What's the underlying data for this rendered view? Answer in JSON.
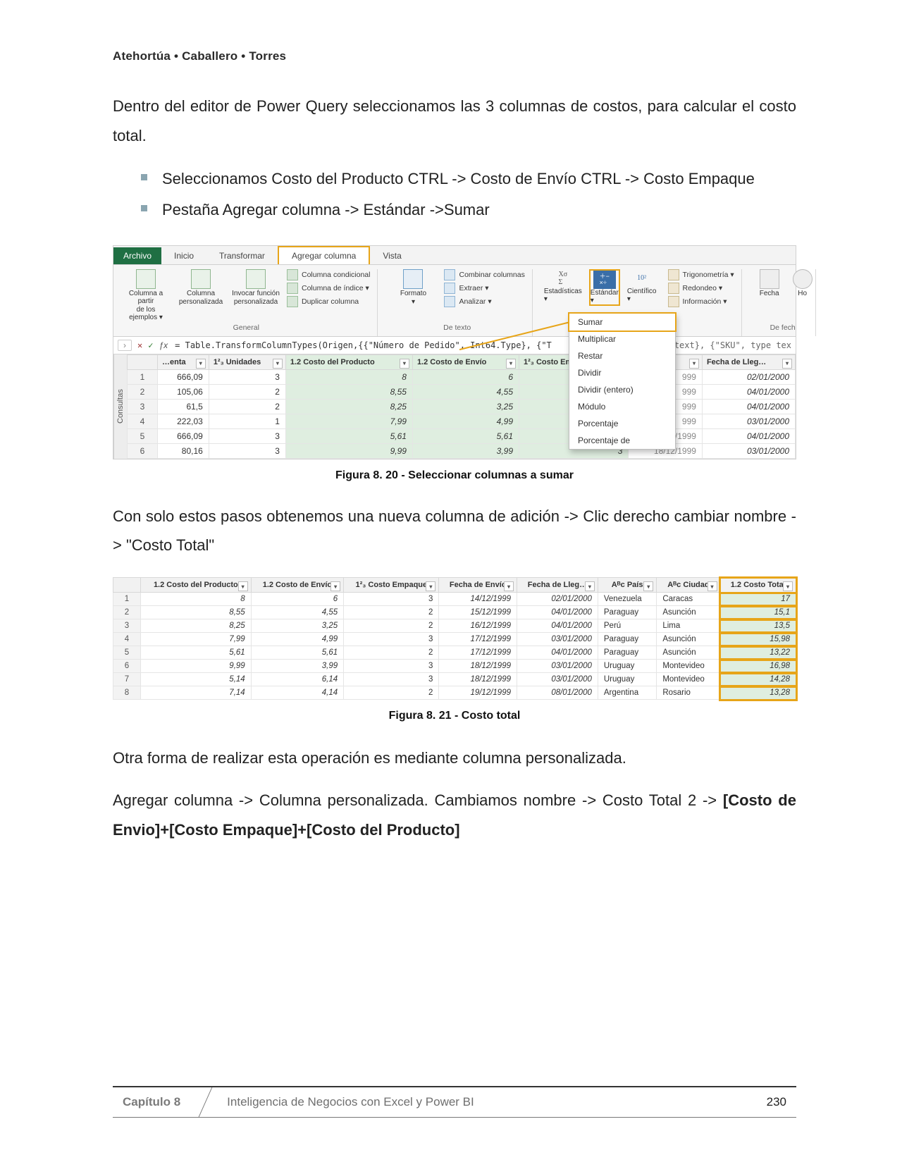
{
  "running_head": "Atehortúa • Caballero • Torres",
  "intro": "Dentro del editor de Power Query seleccionamos las 3 columnas de costos, para calcular el costo total.",
  "bullets": [
    "Seleccionamos Costo del Producto CTRL -> Costo de Envío CTRL -> Costo Empaque",
    "Pestaña Agregar columna -> Estándar ->Sumar"
  ],
  "fig20": {
    "tabs": {
      "file": "Archivo",
      "items": [
        "Inicio",
        "Transformar",
        "Agregar columna",
        "Vista"
      ],
      "activeIndex": 2
    },
    "ribbon": {
      "general": {
        "label": "General",
        "big": [
          {
            "l1": "Columna a partir",
            "l2": "de los ejemplos ▾"
          },
          {
            "l1": "Columna",
            "l2": "personalizada"
          },
          {
            "l1": "Invocar función",
            "l2": "personalizada"
          }
        ],
        "stack": [
          "Columna condicional",
          "Columna de índice ▾",
          "Duplicar columna"
        ]
      },
      "texto": {
        "label": "De texto",
        "big": {
          "l1": "Formato",
          "l2": "▾"
        },
        "stack": [
          "Combinar columnas",
          "Extraer ▾",
          "Analizar ▾"
        ]
      },
      "num": {
        "label": "",
        "items": [
          {
            "icon": "Χσ / Σ",
            "label": "Estadísticas ▾"
          },
          {
            "icon": "+− / ×÷",
            "label": "Estándar ▾",
            "hi": true
          },
          {
            "icon": "10²",
            "label": "Científico ▾"
          }
        ],
        "extra": [
          "Trigonometría ▾",
          "Redondeo ▾",
          "Información ▾"
        ]
      },
      "fecha": {
        "label": "De fech",
        "items": [
          "Fecha",
          "Ho"
        ]
      }
    },
    "dropdown": [
      "Sumar",
      "Multiplicar",
      "Restar",
      "Dividir",
      "Dividir (entero)",
      "Módulo",
      "Porcentaje",
      "Porcentaje de"
    ],
    "formula_left": "= Table.TransformColumnTypes(Origen,{{\"Número de Pedido\", Int64.Type}, {\"T",
    "formula_right": "text}, {\"SKU\", type tex",
    "columns": [
      "…enta",
      "1²₃ Unidades",
      "1.2 Costo del Producto",
      "1.2 Costo de Envío",
      "1²₃ Costo Empaque",
      "",
      "Fecha de Lleg…"
    ],
    "date_tail": [
      "999",
      "999",
      "999",
      "999",
      "17/12/1999",
      "18/12/1999"
    ],
    "rows": [
      {
        "n": 1,
        "venta": "666,09",
        "uni": "3",
        "cp": "8",
        "ce": "6",
        "cq": "",
        "fl": "02/01/2000"
      },
      {
        "n": 2,
        "venta": "105,06",
        "uni": "2",
        "cp": "8,55",
        "ce": "4,55",
        "cq": "",
        "fl": "04/01/2000"
      },
      {
        "n": 3,
        "venta": "61,5",
        "uni": "2",
        "cp": "8,25",
        "ce": "3,25",
        "cq": "",
        "fl": "04/01/2000"
      },
      {
        "n": 4,
        "venta": "222,03",
        "uni": "1",
        "cp": "7,99",
        "ce": "4,99",
        "cq": "",
        "fl": "03/01/2000"
      },
      {
        "n": 5,
        "venta": "666,09",
        "uni": "3",
        "cp": "5,61",
        "ce": "5,61",
        "cq": "",
        "fl": "04/01/2000"
      },
      {
        "n": 6,
        "venta": "80,16",
        "uni": "3",
        "cp": "9,99",
        "ce": "3,99",
        "cq": "3",
        "fl": "03/01/2000"
      }
    ],
    "sidetab": "Consultas",
    "caption": "Figura 8. 20 - Seleccionar columnas a sumar"
  },
  "mid_para": "Con solo estos pasos obtenemos una nueva columna de adición -> Clic derecho cambiar nombre -> \"Costo Total\"",
  "fig21": {
    "columns": [
      "1.2 Costo del Producto",
      "1.2 Costo de Envío",
      "1²₃ Costo Empaque",
      "Fecha de Envío",
      "Fecha de Lleg…",
      "Aᴮc País",
      "Aᴮc Ciudad",
      "1.2 Costo Total"
    ],
    "rows": [
      {
        "n": 1,
        "cp": "8",
        "ce": "6",
        "cq": "3",
        "fe": "14/12/1999",
        "fl": "02/01/2000",
        "pais": "Venezuela",
        "ciu": "Caracas",
        "ct": "17"
      },
      {
        "n": 2,
        "cp": "8,55",
        "ce": "4,55",
        "cq": "2",
        "fe": "15/12/1999",
        "fl": "04/01/2000",
        "pais": "Paraguay",
        "ciu": "Asunción",
        "ct": "15,1"
      },
      {
        "n": 3,
        "cp": "8,25",
        "ce": "3,25",
        "cq": "2",
        "fe": "16/12/1999",
        "fl": "04/01/2000",
        "pais": "Perú",
        "ciu": "Lima",
        "ct": "13,5"
      },
      {
        "n": 4,
        "cp": "7,99",
        "ce": "4,99",
        "cq": "3",
        "fe": "17/12/1999",
        "fl": "03/01/2000",
        "pais": "Paraguay",
        "ciu": "Asunción",
        "ct": "15,98"
      },
      {
        "n": 5,
        "cp": "5,61",
        "ce": "5,61",
        "cq": "2",
        "fe": "17/12/1999",
        "fl": "04/01/2000",
        "pais": "Paraguay",
        "ciu": "Asunción",
        "ct": "13,22"
      },
      {
        "n": 6,
        "cp": "9,99",
        "ce": "3,99",
        "cq": "3",
        "fe": "18/12/1999",
        "fl": "03/01/2000",
        "pais": "Uruguay",
        "ciu": "Montevideo",
        "ct": "16,98"
      },
      {
        "n": 7,
        "cp": "5,14",
        "ce": "6,14",
        "cq": "3",
        "fe": "18/12/1999",
        "fl": "03/01/2000",
        "pais": "Uruguay",
        "ciu": "Montevideo",
        "ct": "14,28"
      },
      {
        "n": 8,
        "cp": "7,14",
        "ce": "4,14",
        "cq": "2",
        "fe": "19/12/1999",
        "fl": "08/01/2000",
        "pais": "Argentina",
        "ciu": "Rosario",
        "ct": "13,28"
      }
    ],
    "caption": "Figura 8. 21 - Costo total"
  },
  "outro1": "Otra forma de realizar esta operación es mediante columna personalizada.",
  "outro2_a": "Agregar columna -> Columna personalizada. Cambiamos nombre -> Costo Total 2 -> ",
  "outro2_b": "[Costo de Envio]+[Costo Empaque]+[Costo del Producto]",
  "footer": {
    "chapter": "Capítulo 8",
    "title": "Inteligencia de Negocios con Excel y Power BI",
    "page": "230"
  }
}
